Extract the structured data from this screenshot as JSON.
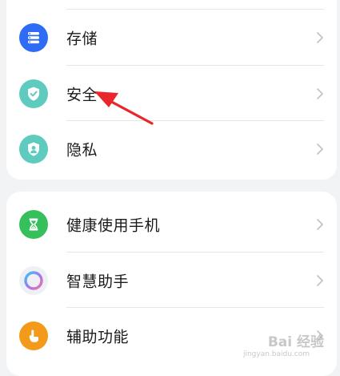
{
  "card1": {
    "items": [
      {
        "label": "存储",
        "icon": "storage-icon",
        "color": "#2f6cf6"
      },
      {
        "label": "安全",
        "icon": "shield-check-icon",
        "color": "#5fcbbf"
      },
      {
        "label": "隐私",
        "icon": "privacy-person-icon",
        "color": "#5fcbbf"
      }
    ]
  },
  "card2": {
    "items": [
      {
        "label": "健康使用手机",
        "icon": "hourglass-icon",
        "color": "#36c05c"
      },
      {
        "label": "智慧助手",
        "icon": "ring-icon",
        "color": "#9d7bf2"
      },
      {
        "label": "辅助功能",
        "icon": "hand-icon",
        "color": "#f39a1b"
      }
    ]
  },
  "annotation": {
    "color": "#e8262b"
  },
  "watermark": {
    "text": "Bai 经验",
    "sub": "jingyan.baidu.com"
  }
}
